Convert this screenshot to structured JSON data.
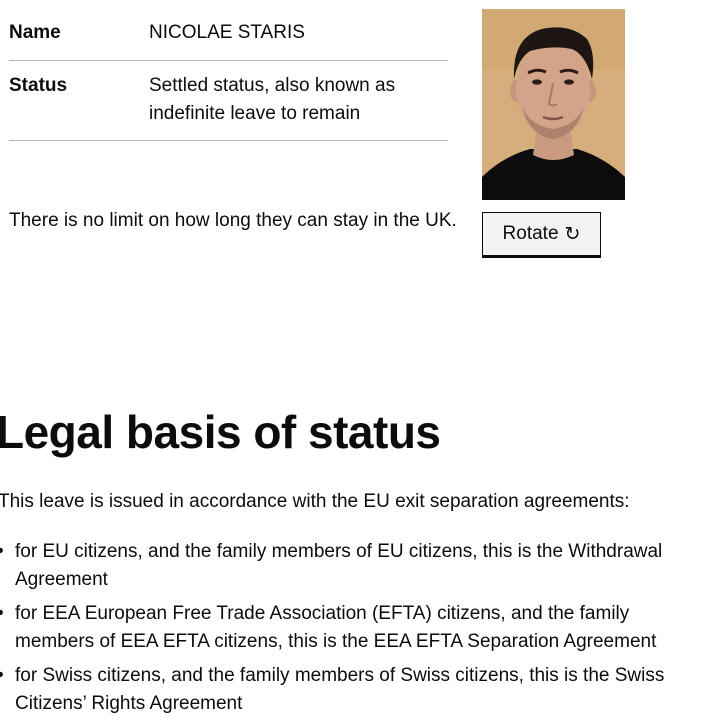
{
  "summary": {
    "name_key": "Name",
    "name_value": "NICOLAE STARIS",
    "status_key": "Status",
    "status_value": "Settled status, also known as indefinite leave to remain"
  },
  "stay_text": "There is no limit on how long they can stay in the UK.",
  "photo": {
    "icon": "person-photo",
    "background_color": "#d3ab78"
  },
  "rotate_button": {
    "label": "Rotate",
    "icon": "↻"
  },
  "legal": {
    "heading": "Legal basis of status",
    "intro": "This leave is issued in accordance with the EU exit separation agreements:",
    "bullet": "•",
    "items": [
      "for EU citizens, and the family members of EU citizens, this is the Withdrawal Agreement",
      "for EEA European Free Trade Association (EFTA) citizens, and the family members of EEA EFTA citizens, this is the EEA EFTA Separation Agreement",
      "for Swiss citizens, and the family members of Swiss citizens, this is the Swiss Citizens’ Rights Agreement"
    ]
  }
}
